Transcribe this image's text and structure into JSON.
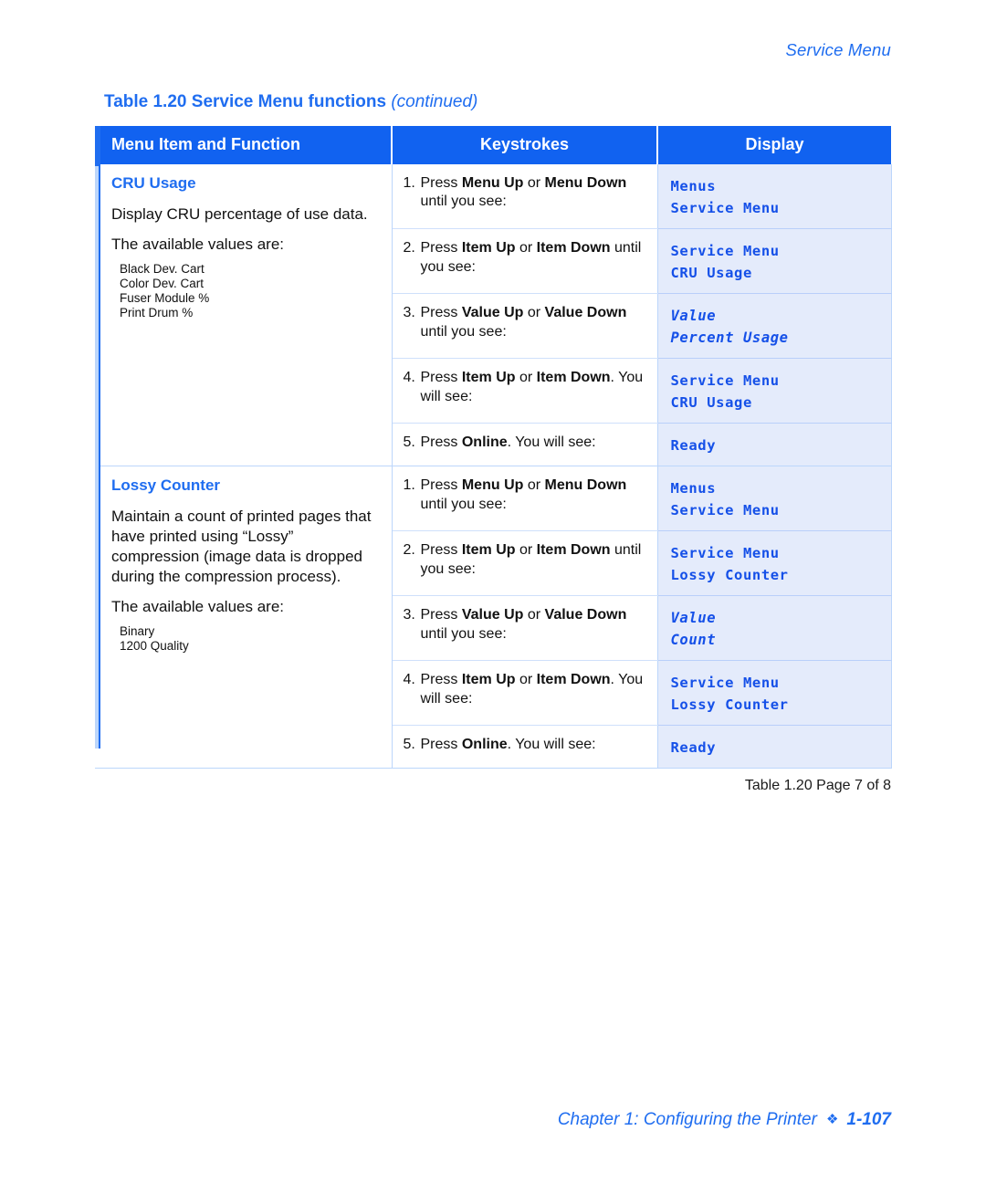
{
  "running_head": "Service Menu",
  "table_caption": {
    "label": "Table 1.20",
    "title": "Service Menu functions",
    "continued": "(continued)"
  },
  "table": {
    "headers": {
      "menu": "Menu Item and Function",
      "keystrokes": "Keystrokes",
      "display": "Display"
    },
    "sections": [
      {
        "title": "CRU Usage",
        "description": "Display CRU percentage of use data.",
        "available_label": "The available values are:",
        "values": [
          "Black Dev. Cart",
          "Color Dev. Cart",
          "Fuser Module %",
          "Print Drum %"
        ],
        "steps": [
          {
            "num": "1.",
            "parts": [
              {
                "t": "Press ",
                "b": false
              },
              {
                "t": "Menu Up",
                "b": true
              },
              {
                "t": " or ",
                "b": false
              },
              {
                "t": "Menu Down",
                "b": true
              },
              {
                "t": " until you see:",
                "b": false
              }
            ],
            "display": [
              {
                "text": "Menus",
                "italic": false
              },
              {
                "text": "Service Menu",
                "italic": false
              }
            ]
          },
          {
            "num": "2.",
            "parts": [
              {
                "t": "Press ",
                "b": false
              },
              {
                "t": "Item Up",
                "b": true
              },
              {
                "t": " or ",
                "b": false
              },
              {
                "t": "Item Down",
                "b": true
              },
              {
                "t": " until you see:",
                "b": false
              }
            ],
            "display": [
              {
                "text": "Service Menu",
                "italic": false
              },
              {
                "text": "CRU Usage",
                "italic": false
              }
            ]
          },
          {
            "num": "3.",
            "parts": [
              {
                "t": "Press ",
                "b": false
              },
              {
                "t": "Value Up",
                "b": true
              },
              {
                "t": " or ",
                "b": false
              },
              {
                "t": "Value Down",
                "b": true
              },
              {
                "t": " until you see:",
                "b": false
              }
            ],
            "display": [
              {
                "text": "Value",
                "italic": true
              },
              {
                "text": "Percent Usage",
                "italic": true
              }
            ]
          },
          {
            "num": "4.",
            "parts": [
              {
                "t": "Press ",
                "b": false
              },
              {
                "t": "Item Up",
                "b": true
              },
              {
                "t": " or ",
                "b": false
              },
              {
                "t": "Item Down",
                "b": true
              },
              {
                "t": ". You will see:",
                "b": false
              }
            ],
            "display": [
              {
                "text": "Service Menu",
                "italic": false
              },
              {
                "text": "CRU Usage",
                "italic": false
              }
            ]
          },
          {
            "num": "5.",
            "parts": [
              {
                "t": "Press ",
                "b": false
              },
              {
                "t": "Online",
                "b": true
              },
              {
                "t": ". You will see:",
                "b": false
              }
            ],
            "display": [
              {
                "text": "Ready",
                "italic": false
              }
            ]
          }
        ]
      },
      {
        "title": "Lossy Counter",
        "description": "Maintain a count of printed pages that have printed using “Lossy” compression (image data is dropped during the compression process).",
        "available_label": "The available values are:",
        "values": [
          "Binary",
          "1200 Quality"
        ],
        "steps": [
          {
            "num": "1.",
            "parts": [
              {
                "t": "Press ",
                "b": false
              },
              {
                "t": "Menu Up",
                "b": true
              },
              {
                "t": " or ",
                "b": false
              },
              {
                "t": "Menu Down",
                "b": true
              },
              {
                "t": " until you see:",
                "b": false
              }
            ],
            "display": [
              {
                "text": "Menus",
                "italic": false
              },
              {
                "text": "Service Menu",
                "italic": false
              }
            ]
          },
          {
            "num": "2.",
            "parts": [
              {
                "t": "Press ",
                "b": false
              },
              {
                "t": "Item Up",
                "b": true
              },
              {
                "t": " or ",
                "b": false
              },
              {
                "t": "Item Down",
                "b": true
              },
              {
                "t": " until you see:",
                "b": false
              }
            ],
            "display": [
              {
                "text": "Service Menu",
                "italic": false
              },
              {
                "text": "Lossy Counter",
                "italic": false
              }
            ]
          },
          {
            "num": "3.",
            "parts": [
              {
                "t": "Press ",
                "b": false
              },
              {
                "t": "Value Up",
                "b": true
              },
              {
                "t": " or ",
                "b": false
              },
              {
                "t": "Value Down",
                "b": true
              },
              {
                "t": " until you see:",
                "b": false
              }
            ],
            "display": [
              {
                "text": "Value",
                "italic": true
              },
              {
                "text": "Count",
                "italic": true
              }
            ]
          },
          {
            "num": "4.",
            "parts": [
              {
                "t": "Press ",
                "b": false
              },
              {
                "t": "Item Up",
                "b": true
              },
              {
                "t": " or ",
                "b": false
              },
              {
                "t": "Item Down",
                "b": true
              },
              {
                "t": ". You will see:",
                "b": false
              }
            ],
            "display": [
              {
                "text": "Service Menu",
                "italic": false
              },
              {
                "text": "Lossy Counter",
                "italic": false
              }
            ]
          },
          {
            "num": "5.",
            "parts": [
              {
                "t": "Press ",
                "b": false
              },
              {
                "t": "Online",
                "b": true
              },
              {
                "t": ". You will see:",
                "b": false
              }
            ],
            "display": [
              {
                "text": "Ready",
                "italic": false
              }
            ]
          }
        ]
      }
    ],
    "page_ref": "Table 1.20  Page 7 of 8"
  },
  "page_footer": {
    "chapter": "Chapter 1: Configuring the Printer",
    "diamond": "❖",
    "page": "1-107"
  },
  "colors": {
    "accent_blue": "#1f6df0",
    "header_blue": "#1162f0",
    "display_bg": "#e4ebfb",
    "display_text": "#1550e8",
    "rule_blue": "#bcd6fb"
  }
}
